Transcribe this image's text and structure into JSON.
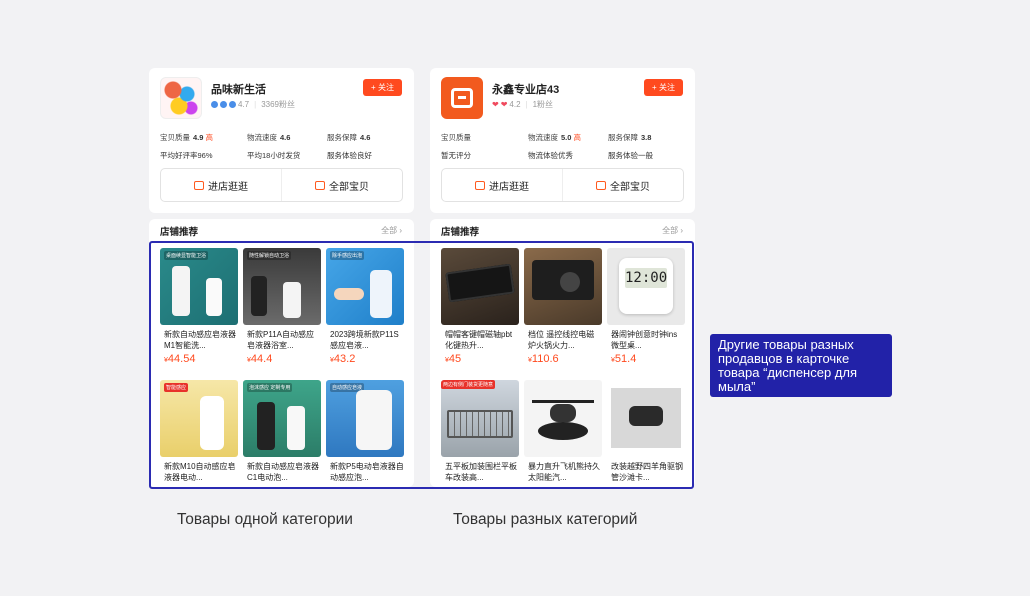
{
  "store_left": {
    "name": "品味新生活",
    "rating": "4.7",
    "followers": "3369粉丝",
    "follow_label": "+ 关注",
    "stats": [
      {
        "key": "宝贝质量",
        "value": "4.9",
        "badge": "高",
        "sub": "平均好评率96%"
      },
      {
        "key": "物流速度",
        "value": "4.6",
        "badge": "",
        "sub": "平均18小时发货"
      },
      {
        "key": "服务保障",
        "value": "4.6",
        "badge": "",
        "sub": "服务体验良好"
      }
    ],
    "enter_label": "进店逛逛",
    "all_label": "全部宝贝"
  },
  "store_right": {
    "name": "永鑫专业店43",
    "rating": "4.2",
    "followers": "1粉丝",
    "follow_label": "+ 关注",
    "stats": [
      {
        "key": "宝贝质量",
        "value": "",
        "badge": "",
        "sub": "暂无评分"
      },
      {
        "key": "物流速度",
        "value": "5.0",
        "badge": "高",
        "sub": "物流体验优秀"
      },
      {
        "key": "服务保障",
        "value": "3.8",
        "badge": "",
        "sub": "服务体验一般"
      }
    ],
    "enter_label": "进店逛逛",
    "all_label": "全部宝贝"
  },
  "rec_left": {
    "title": "店铺推荐",
    "all": "全部",
    "items": [
      {
        "name": "新款自动感应皂液器M1智能洗...",
        "price": "44.54",
        "tag": "桌面续显智能卫浴"
      },
      {
        "name": "新款P11A自动感应皂液器浴室...",
        "price": "44.4",
        "tag": "随性解锁自动卫浴"
      },
      {
        "name": "2023跨境新款P11S感应皂液...",
        "price": "43.2",
        "tag": "除手感应出泡"
      },
      {
        "name": "新款M10自动感应皂液器电动...",
        "price": "",
        "tag": "智能感应"
      },
      {
        "name": "新款自动感应皂液器C1电动泡...",
        "price": "",
        "tag": "泡沫感应 定制专用"
      },
      {
        "name": "新款P5电动皂液器自动感应泡...",
        "price": "",
        "tag": "自动感应皂液"
      }
    ]
  },
  "rec_right": {
    "title": "店铺推荐",
    "all": "全部",
    "items": [
      {
        "name": "帽帽客键帽磁轴pbt化键热升...",
        "price": "45",
        "tag": ""
      },
      {
        "name": "档位 遥控线控电磁炉火锅火力...",
        "price": "110.6",
        "tag": ""
      },
      {
        "name": "器闹钟创意时钟ins微型桌...",
        "price": "51.4",
        "tag": ""
      },
      {
        "name": "五平板加装围栏平板车改装高...",
        "price": "",
        "tag": "两边有侧门装货更随意"
      },
      {
        "name": "暴力直升飞机熊持久太阳能汽...",
        "price": "",
        "tag": ""
      },
      {
        "name": "改装越野四羊角驱钢管沙滩卡...",
        "price": "",
        "tag": ""
      }
    ]
  },
  "currency": "¥",
  "note": "Другие товары разных продавцов в карточке товара “диспенсер для мыла”",
  "captions": {
    "left": "Товары одной категории",
    "right": "Товары разных категорий"
  },
  "colors": {
    "accent": "#ff4a1f",
    "highlight": "#2b2bb2"
  }
}
